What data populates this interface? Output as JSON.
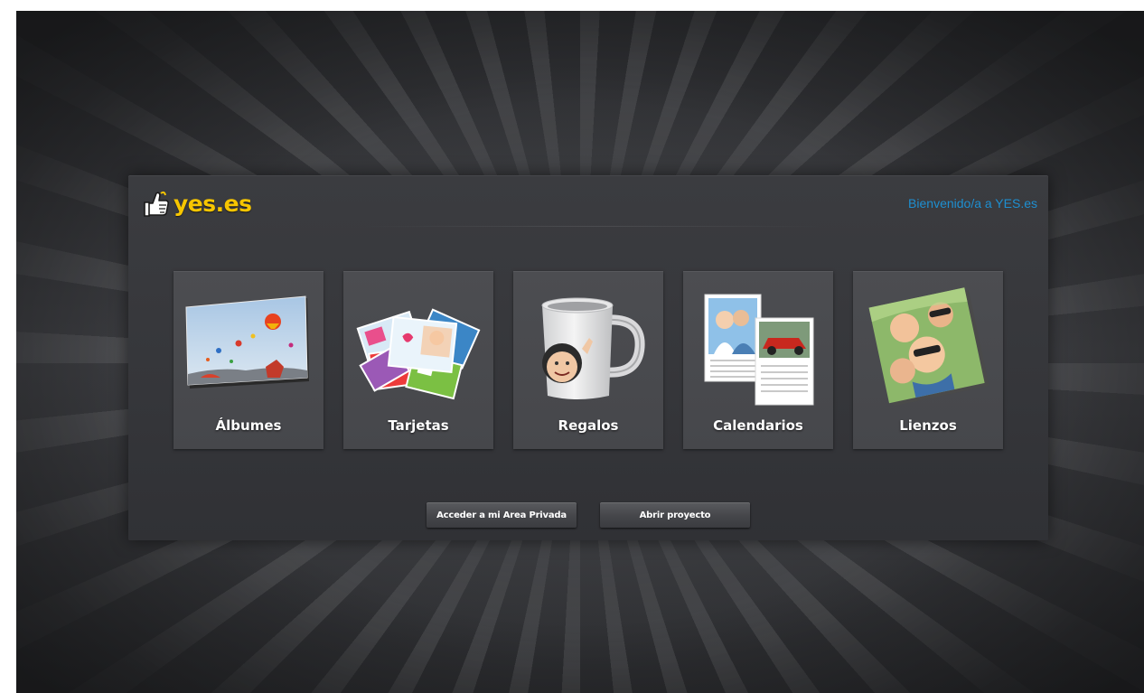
{
  "header": {
    "logo_text": "yes.es",
    "welcome_text": "Bienvenido/a a YES.es"
  },
  "categories": [
    {
      "label": "Álbumes",
      "icon": "photo-album-icon"
    },
    {
      "label": "Tarjetas",
      "icon": "greeting-cards-icon"
    },
    {
      "label": "Regalos",
      "icon": "mug-icon"
    },
    {
      "label": "Calendarios",
      "icon": "calendar-icon"
    },
    {
      "label": "Lienzos",
      "icon": "canvas-icon"
    }
  ],
  "buttons": {
    "private_area": "Acceder a mi Area Privada",
    "open_project": "Abrir proyecto"
  },
  "colors": {
    "logo": "#f7c600",
    "welcome_link": "#1e8fd0",
    "panel": "#37383c",
    "tile": "#4a4b4f"
  }
}
